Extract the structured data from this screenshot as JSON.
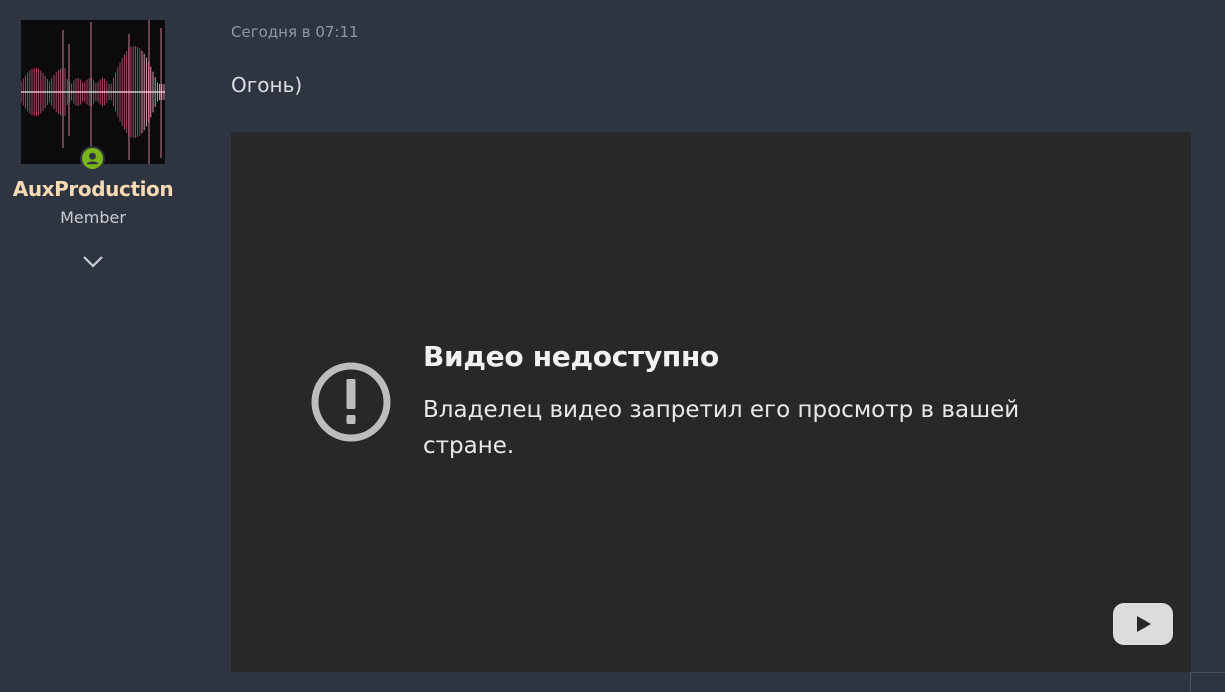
{
  "user": {
    "username": "AuxProduction",
    "role": "Member",
    "avatar_icon": "waveform-avatar",
    "status_icon": "online-user-icon",
    "status_color": "#7bb51b",
    "username_color": "#f7d9b4"
  },
  "post": {
    "date": "Сегодня в 07:11",
    "text": "Огонь)"
  },
  "video": {
    "error_title": "Видео недоступно",
    "error_message": "Владелец видео запретил его просмотр в вашей стране.",
    "error_icon": "exclamation-circle-icon",
    "logo_icon": "youtube-play-icon"
  },
  "colors": {
    "page_background": "#2f3441",
    "video_background": "#282828"
  }
}
